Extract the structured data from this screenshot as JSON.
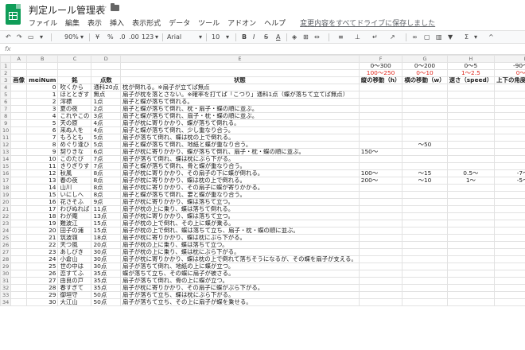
{
  "doc": {
    "title": "判定ルール管理表"
  },
  "menu": {
    "items": [
      "ファイル",
      "編集",
      "表示",
      "挿入",
      "表示形式",
      "データ",
      "ツール",
      "アドオン",
      "ヘルプ"
    ],
    "save_status": "変更内容をすべてドライブに保存しました"
  },
  "toolbar": {
    "zoom": "90%",
    "currency": "¥",
    "percent": "%",
    "decimals1": ".0",
    "decimals2": ".00",
    "format": "123",
    "font": "Arial",
    "size": "10",
    "bold": "B",
    "italic": "I",
    "strike": "S",
    "textcolor": "A"
  },
  "formula": {
    "fx": "fx"
  },
  "columns": [
    "A",
    "B",
    "C",
    "D",
    "E",
    "F",
    "G",
    "H",
    "I"
  ],
  "row1": {
    "F": "0〜300",
    "G": "0〜200",
    "H": "0〜5",
    "I": "-90〜90"
  },
  "row2": {
    "F": "100〜250",
    "G": "0〜10",
    "H": "1〜2.5",
    "I": "0〜20"
  },
  "headers": {
    "A": "画像",
    "B": "meiNum",
    "C": "銘",
    "D": "点数",
    "E": "状態",
    "F": "縦の移動（h）",
    "G": "横の移動（w）",
    "H": "速さ（speed）",
    "I": "上下の角度（beta）",
    "J": "左右の"
  },
  "rows": [
    {
      "n": "4",
      "b": "0",
      "c": "吹くから",
      "d": "通科20点",
      "e": "枕が倒れる。※扇子が立てば無点",
      "f": "",
      "g": "",
      "h": "",
      "i": ""
    },
    {
      "n": "5",
      "b": "1",
      "c": "ほととぎす",
      "d": "無点",
      "e": "扇子が枕を落とさない。※確率を打てば「こつり」通科1点（蝶が落ちて立てば無点）",
      "f": "",
      "g": "",
      "h": "",
      "i": ""
    },
    {
      "n": "6",
      "b": "2",
      "c": "澪標",
      "d": "1点",
      "e": "扇子と蝶が落ちて倒れる。",
      "f": "",
      "g": "",
      "h": "",
      "i": ""
    },
    {
      "n": "7",
      "b": "3",
      "c": "夏の夜",
      "d": "2点",
      "e": "扇子と蝶が落ちて倒れ、枕・扇子・蝶の順に並ぶ。",
      "f": "",
      "g": "",
      "h": "",
      "i": ""
    },
    {
      "n": "8",
      "b": "4",
      "c": "これやこの",
      "d": "3点",
      "e": "扇子と蝶が落ちて倒れ、扇子・枕・蝶の順に並ぶ。",
      "f": "",
      "g": "",
      "h": "",
      "i": ""
    },
    {
      "n": "9",
      "b": "5",
      "c": "天の原",
      "d": "4点",
      "e": "扇子が枕に寄りかかり、蝶が落ちて倒れる。",
      "f": "",
      "g": "",
      "h": "",
      "i": ""
    },
    {
      "n": "10",
      "b": "6",
      "c": "来ぬ人を",
      "d": "4点",
      "e": "扇子と蝶が落ちて倒れ、少し重なり合う。",
      "f": "",
      "g": "",
      "h": "",
      "i": ""
    },
    {
      "n": "11",
      "b": "7",
      "c": "もろとも",
      "d": "5点",
      "e": "扇子が落ちて倒れ、蝶は枕の上で倒れる。",
      "f": "",
      "g": "",
      "h": "",
      "i": ""
    },
    {
      "n": "12",
      "b": "8",
      "c": "めぐり逢ひ",
      "d": "5点",
      "e": "扇子と蝶が落ちて倒れ、地紙と蝶が重なり合う。",
      "f": "",
      "g": "〜50",
      "h": "",
      "i": ""
    },
    {
      "n": "13",
      "b": "9",
      "c": "契りきな",
      "d": "6点",
      "e": "扇子が枕に寄りかかり、蝶が落ちて倒れ、扇子・枕・蝶の順に並ぶ。",
      "f": "150〜",
      "g": "",
      "h": "",
      "i": ""
    },
    {
      "n": "14",
      "b": "10",
      "c": "このたび",
      "d": "7点",
      "e": "扇子が落ちて倒れ、蝶は枕にぶら下がる。",
      "f": "",
      "g": "",
      "h": "",
      "i": ""
    },
    {
      "n": "15",
      "b": "11",
      "c": "きりぎりす",
      "d": "7点",
      "e": "扇子と蝶が落ちて倒れ、骨と蝶が重なり合う。",
      "f": "",
      "g": "",
      "h": "",
      "i": ""
    },
    {
      "n": "16",
      "b": "12",
      "c": "秋風",
      "d": "8点",
      "e": "扇子が枕に寄りかかり、その扇子の下に蝶が倒れる。",
      "f": "100〜",
      "g": "〜15",
      "h": "0.5〜",
      "i": "-7〜7"
    },
    {
      "n": "17",
      "b": "13",
      "c": "春の夜",
      "d": "8点",
      "e": "扇子が枕に寄りかかり、蝶は枕の上で倒れる。",
      "f": "200〜",
      "g": "〜10",
      "h": "1〜",
      "i": "-5〜5"
    },
    {
      "n": "18",
      "b": "14",
      "c": "山川",
      "d": "8点",
      "e": "扇子が枕に寄りかかり、その扇子に蝶が寄りかかる。",
      "f": "",
      "g": "",
      "h": "",
      "i": ""
    },
    {
      "n": "19",
      "b": "15",
      "c": "いにしへ",
      "d": "8点",
      "e": "扇子と蝶が落ちて倒れ、要と蝶が重なり合う。",
      "f": "",
      "g": "",
      "h": "",
      "i": ""
    },
    {
      "n": "20",
      "b": "16",
      "c": "花さそふ",
      "d": "9点",
      "e": "扇子が枕に寄りかかり、蝶は落ちて立つ。",
      "f": "",
      "g": "",
      "h": "",
      "i": ""
    },
    {
      "n": "21",
      "b": "17",
      "c": "わびぬれば",
      "d": "11点",
      "e": "扇子が枕の上に乗り、蝶は落ちて倒れる。",
      "f": "",
      "g": "",
      "h": "",
      "i": ""
    },
    {
      "n": "22",
      "b": "18",
      "c": "わが庵",
      "d": "13点",
      "e": "扇子が枕に寄りかかり、蝶は落ちて立つ。",
      "f": "",
      "g": "",
      "h": "",
      "i": ""
    },
    {
      "n": "23",
      "b": "19",
      "c": "難波江",
      "d": "15点",
      "e": "扇子が枕の上で倒れ、その上に蝶が乗る。",
      "f": "",
      "g": "",
      "h": "",
      "i": ""
    },
    {
      "n": "24",
      "b": "20",
      "c": "田子の浦",
      "d": "15点",
      "e": "扇子が枕の上で倒れ、蝶は落ちて立ち、扇子・枕・蝶の順に並ぶ。",
      "f": "",
      "g": "",
      "h": "",
      "i": ""
    },
    {
      "n": "25",
      "b": "21",
      "c": "筑波嶺",
      "d": "18点",
      "e": "扇子が枕に寄りかかり、蝶は枕にぶら下がる。",
      "f": "",
      "g": "",
      "h": "",
      "i": ""
    },
    {
      "n": "26",
      "b": "22",
      "c": "天つ風",
      "d": "20点",
      "e": "扇子が枕の上に乗り、蝶は落ちて立つ。",
      "f": "",
      "g": "",
      "h": "",
      "i": ""
    },
    {
      "n": "27",
      "b": "23",
      "c": "あしびき",
      "d": "30点",
      "e": "扇子が枕の上に乗り、蝶は枕にぶら下がる。",
      "f": "",
      "g": "",
      "h": "",
      "i": ""
    },
    {
      "n": "28",
      "b": "24",
      "c": "小倉山",
      "d": "30点",
      "e": "扇子が枕に寄りかかり、蝶は枕の上で倒れて落ちそうになるが、その蝶を扇子が支える。",
      "f": "",
      "g": "",
      "h": "",
      "i": ""
    },
    {
      "n": "29",
      "b": "25",
      "c": "世の中は",
      "d": "30点",
      "e": "扇子が落ちて倒れ、地紙の上に蝶が立つ。",
      "f": "",
      "g": "",
      "h": "",
      "i": ""
    },
    {
      "n": "30",
      "b": "26",
      "c": "恋すてふ",
      "d": "35点",
      "e": "蝶が落ちて立ち、その蝶に扇子が被さる。",
      "f": "",
      "g": "",
      "h": "",
      "i": ""
    },
    {
      "n": "31",
      "b": "27",
      "c": "由良の戸",
      "d": "35点",
      "e": "扇子が落ちて倒れ、骨の上に蝶が立つ。",
      "f": "",
      "g": "",
      "h": "",
      "i": ""
    },
    {
      "n": "32",
      "b": "28",
      "c": "春すぎて",
      "d": "35点",
      "e": "扇子が枕に寄りかかり、その扇子に蝶がぶら下がる。",
      "f": "",
      "g": "",
      "h": "",
      "i": ""
    },
    {
      "n": "33",
      "b": "29",
      "c": "御垣守",
      "d": "50点",
      "e": "扇子が落ちて立ち、蝶は枕にぶら下がる。",
      "f": "",
      "g": "",
      "h": "",
      "i": ""
    },
    {
      "n": "34",
      "b": "30",
      "c": "大江山",
      "d": "50点",
      "e": "扇子が落ちて立ち、その上に扇子が蝶を乗せる。",
      "f": "",
      "g": "",
      "h": "",
      "i": ""
    }
  ]
}
